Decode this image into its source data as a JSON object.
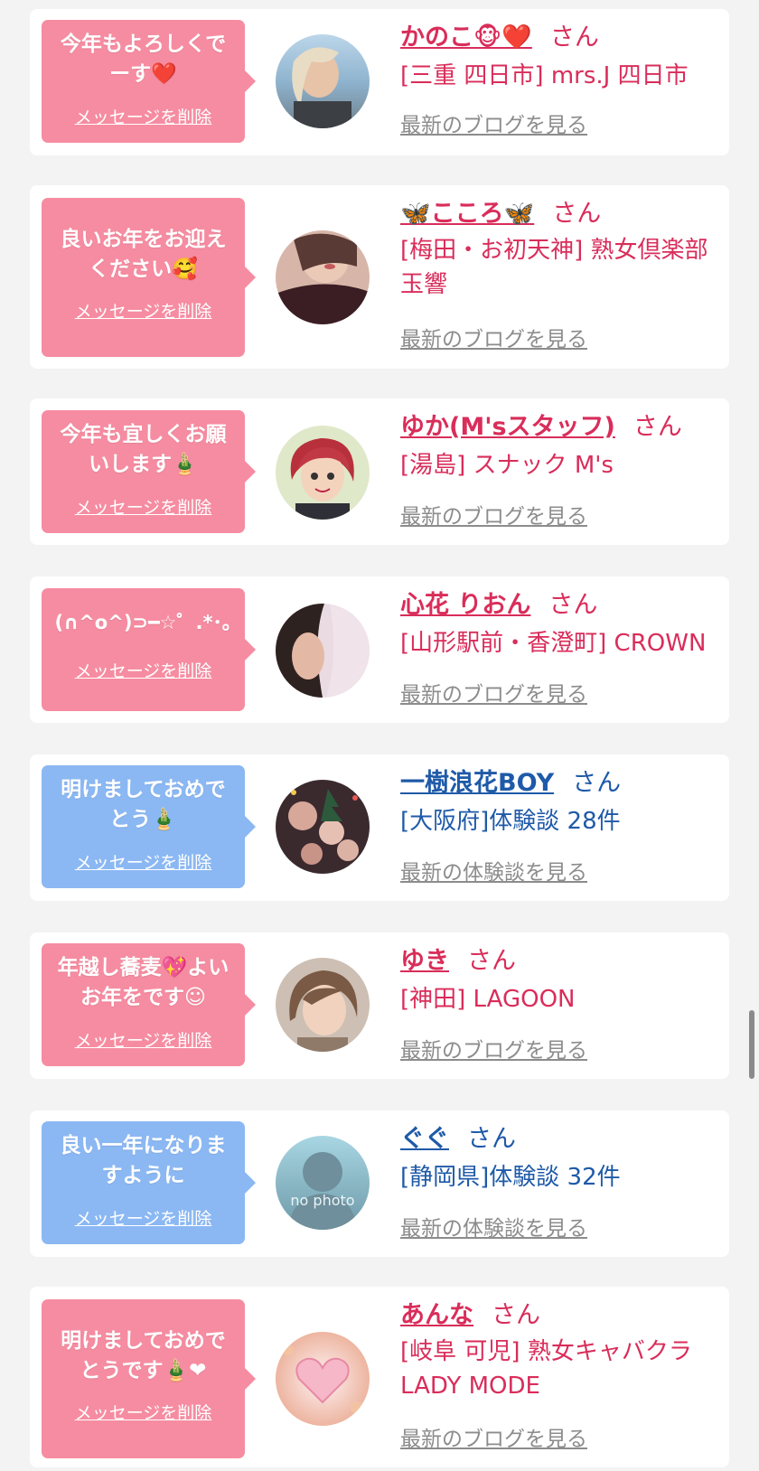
{
  "common": {
    "delete_label": "メッセージを削除",
    "san": "さん",
    "blog_link": "最新のブログを見る",
    "review_link": "最新の体験談を見る"
  },
  "colors": {
    "pink_bubble": "#f68ca1",
    "blue_bubble": "#8bb8f3",
    "pink_text": "#d92d5a",
    "blue_text": "#1f5aa8",
    "link_gray": "#8c8c8c"
  },
  "cards": [
    {
      "message": "今年もよろしくでーす❤️",
      "name": "かのこ🐵❤️",
      "shop": "[三重 四日市] mrs.J 四日市",
      "theme": "pink",
      "link_type": "blog"
    },
    {
      "message": "良いお年をお迎えください🥰",
      "name": "🦋こころ🦋",
      "shop": "[梅田・お初天神] 熟女倶楽部 玉響",
      "theme": "pink",
      "link_type": "blog"
    },
    {
      "message": "今年も宜しくお願いします🎍",
      "name": "ゆか(M'sスタッフ)",
      "shop": "[湯島] スナック M's",
      "theme": "pink",
      "link_type": "blog"
    },
    {
      "message": "(∩^o^)⊃━☆゜.*･｡",
      "name": "心花 りおん",
      "shop": "[山形駅前・香澄町] CROWN",
      "theme": "pink",
      "link_type": "blog"
    },
    {
      "message": "明けましておめでとう🎍",
      "name": "一樹浪花BOY",
      "shop": "[大阪府]体験談 28件",
      "theme": "blue",
      "link_type": "review"
    },
    {
      "message": "年越し蕎麦💖よいお年をです☺",
      "name": "ゆき",
      "shop": "[神田] LAGOON",
      "theme": "pink",
      "link_type": "blog"
    },
    {
      "message": "良い一年になりますように",
      "name": "ぐぐ",
      "shop": "[静岡県]体験談 32件",
      "theme": "blue",
      "link_type": "review",
      "avatar_text": "no photo"
    },
    {
      "message": "明けましておめでとうです🎍❤",
      "name": "あんな",
      "shop": "[岐阜 可児] 熟女キャバクラ LADY MODE",
      "theme": "pink",
      "link_type": "blog"
    }
  ]
}
